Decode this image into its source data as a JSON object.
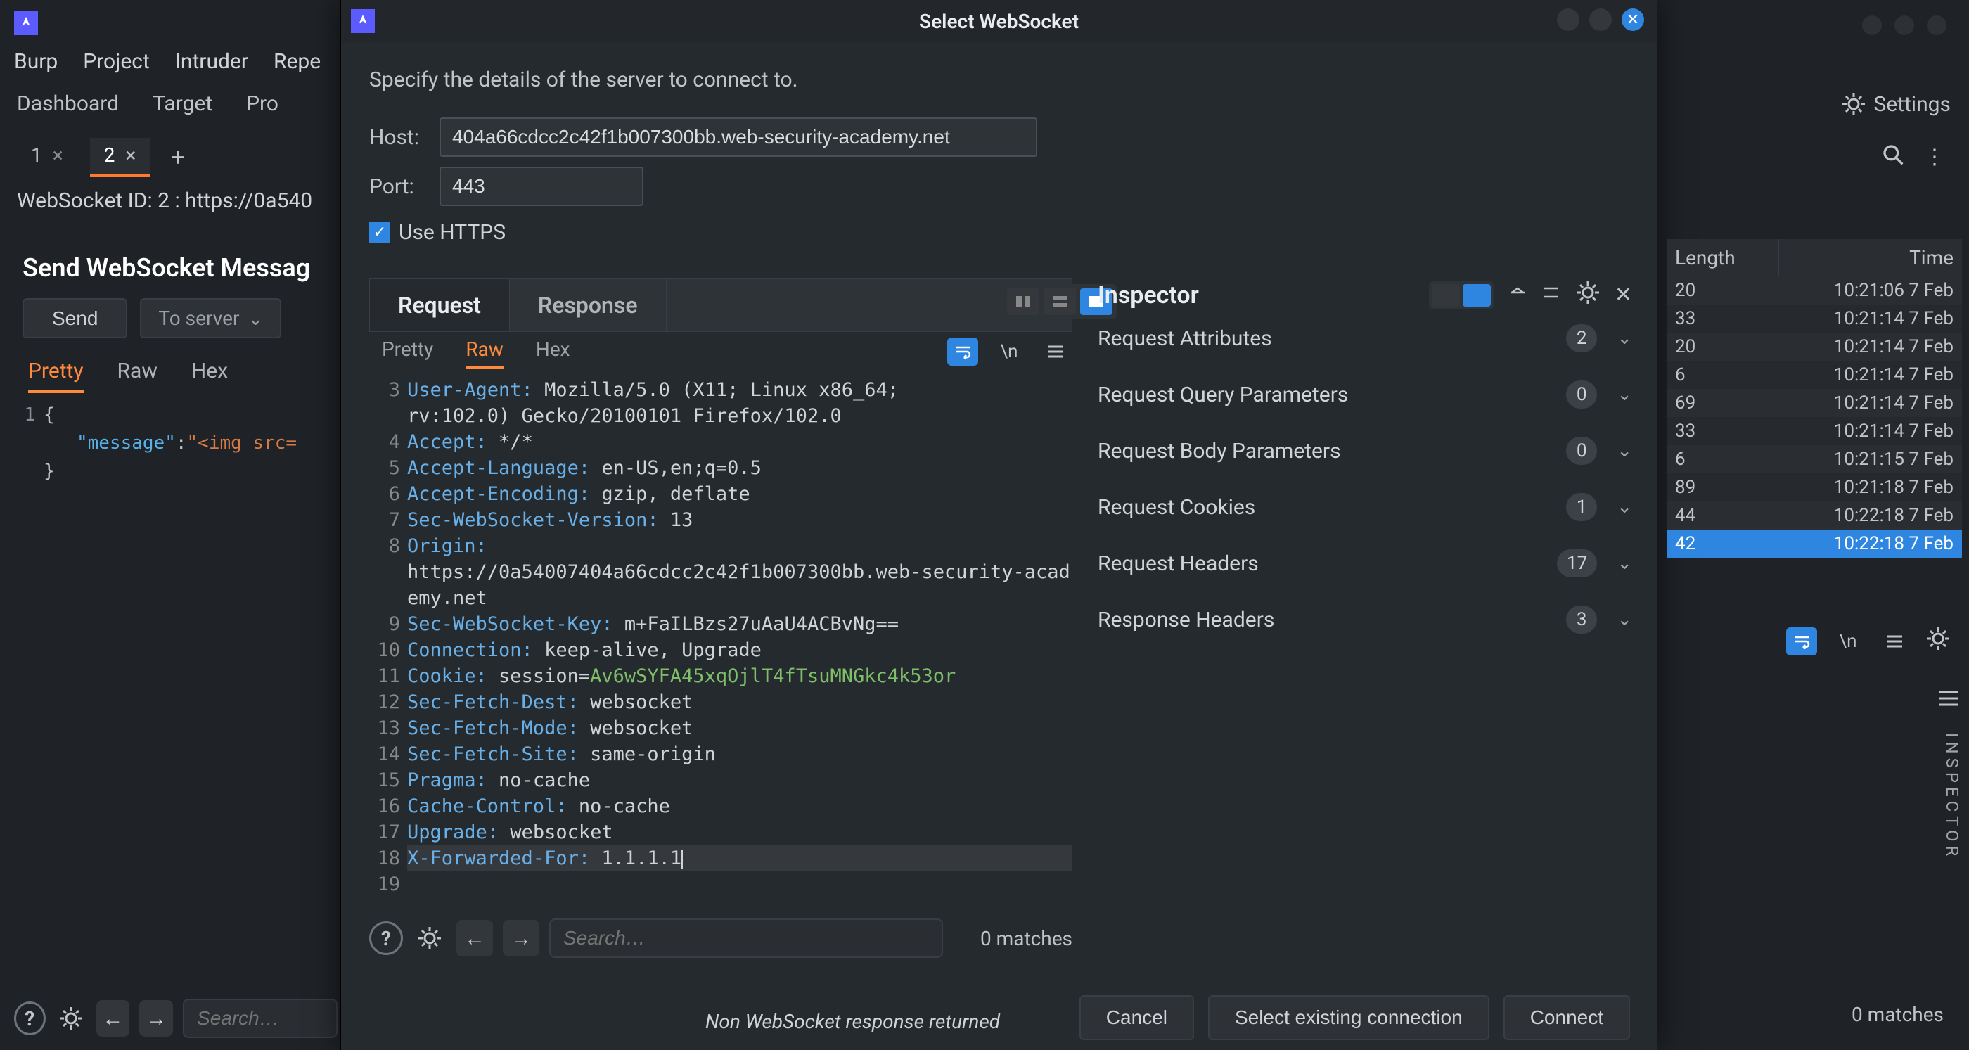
{
  "menubar": [
    "Burp",
    "Project",
    "Intruder",
    "Repe"
  ],
  "tool_tabs": [
    "Dashboard",
    "Target",
    "Pro"
  ],
  "settings_label": "Settings",
  "sub_tabs": [
    {
      "label": "1",
      "close": "×",
      "active": false
    },
    {
      "label": "2",
      "close": "×",
      "active": true
    }
  ],
  "ws_id_line": "WebSocket ID: 2 : https://0a540",
  "send_panel": {
    "title": "Send WebSocket Messag",
    "send_btn": "Send",
    "direction": "To server"
  },
  "left_view_tabs": [
    "Pretty",
    "Raw",
    "Hex"
  ],
  "left_editor": {
    "lines": [
      {
        "n": 1,
        "parts": [
          {
            "t": "{",
            "c": "plain"
          }
        ]
      },
      {
        "n": null,
        "parts": [
          {
            "t": "   ",
            "c": "plain"
          },
          {
            "t": "\"message\"",
            "c": "key"
          },
          {
            "t": ":",
            "c": "plain"
          },
          {
            "t": "\"<img src=",
            "c": "str"
          }
        ]
      },
      {
        "n": null,
        "parts": [
          {
            "t": "}",
            "c": "plain"
          }
        ]
      }
    ]
  },
  "bottom_search_placeholder": "Search…",
  "modal": {
    "title": "Select WebSocket",
    "desc": "Specify the details of the server to connect to.",
    "host_label": "Host:",
    "host_value": "404a66cdcc2c42f1b007300bb.web-security-academy.net",
    "port_label": "Port:",
    "port_value": "443",
    "use_https_label": "Use HTTPS",
    "tabs": {
      "request": "Request",
      "response": "Response"
    },
    "view_tabs": [
      "Pretty",
      "Raw",
      "Hex"
    ],
    "raw_lines": [
      {
        "n": 3,
        "k": "User-Agent:",
        "v": " Mozilla/5.0 (X11; Linux x86_64;"
      },
      {
        "n": null,
        "k": "",
        "v": "rv:102.0) Gecko/20100101 Firefox/102.0"
      },
      {
        "n": 4,
        "k": "Accept:",
        "v": " */*"
      },
      {
        "n": 5,
        "k": "Accept-Language:",
        "v": " en-US,en;q=0.5"
      },
      {
        "n": 6,
        "k": "Accept-Encoding:",
        "v": " gzip, deflate"
      },
      {
        "n": 7,
        "k": "Sec-WebSocket-Version:",
        "v": " 13"
      },
      {
        "n": 8,
        "k": "Origin:",
        "v": ""
      },
      {
        "n": null,
        "k": "",
        "v": "https://0a54007404a66cdcc2c42f1b007300bb.web-security-academy.net"
      },
      {
        "n": 9,
        "k": "Sec-WebSocket-Key:",
        "v": " m+FaILBzs27uAaU4ACBvNg=="
      },
      {
        "n": 10,
        "k": "Connection:",
        "v": " keep-alive, Upgrade"
      },
      {
        "n": 11,
        "k": "Cookie:",
        "v": " session=",
        "cookie": "Av6wSYFA45xqOjlT4fTsuMNGkc4k53or"
      },
      {
        "n": 12,
        "k": "Sec-Fetch-Dest:",
        "v": " websocket"
      },
      {
        "n": 13,
        "k": "Sec-Fetch-Mode:",
        "v": " websocket"
      },
      {
        "n": 14,
        "k": "Sec-Fetch-Site:",
        "v": " same-origin"
      },
      {
        "n": 15,
        "k": "Pragma:",
        "v": " no-cache"
      },
      {
        "n": 16,
        "k": "Cache-Control:",
        "v": " no-cache"
      },
      {
        "n": 17,
        "k": "Upgrade:",
        "v": " websocket"
      },
      {
        "n": 18,
        "k": "X-Forwarded-For:",
        "v": " 1.1.1.1",
        "hl": true,
        "caret": true
      },
      {
        "n": 19,
        "k": "",
        "v": ""
      }
    ],
    "search_placeholder": "Search…",
    "matches": "0 matches",
    "inspector": {
      "title": "Inspector",
      "sections": [
        {
          "label": "Request Attributes",
          "count": "2"
        },
        {
          "label": "Request Query Parameters",
          "count": "0"
        },
        {
          "label": "Request Body Parameters",
          "count": "0"
        },
        {
          "label": "Request Cookies",
          "count": "1"
        },
        {
          "label": "Request Headers",
          "count": "17"
        },
        {
          "label": "Response Headers",
          "count": "3"
        }
      ]
    },
    "status": "Non WebSocket response returned",
    "buttons": {
      "cancel": "Cancel",
      "select": "Select existing connection",
      "connect": "Connect"
    }
  },
  "right_table": {
    "headers": {
      "length": "Length",
      "time": "Time"
    },
    "rows": [
      {
        "len": "20",
        "time": "10:21:06 7 Feb"
      },
      {
        "len": "33",
        "time": "10:21:14 7 Feb"
      },
      {
        "len": "20",
        "time": "10:21:14 7 Feb"
      },
      {
        "len": "6",
        "time": "10:21:14 7 Feb"
      },
      {
        "len": "69",
        "time": "10:21:14 7 Feb"
      },
      {
        "len": "33",
        "time": "10:21:14 7 Feb"
      },
      {
        "len": "6",
        "time": "10:21:15 7 Feb"
      },
      {
        "len": "89",
        "time": "10:21:18 7 Feb"
      },
      {
        "len": "44",
        "time": "10:22:18 7 Feb"
      },
      {
        "len": "42",
        "time": "10:22:18 7 Feb",
        "sel": true
      }
    ]
  },
  "right_matches": "0 matches",
  "inspector_vert": "INSPECTOR"
}
